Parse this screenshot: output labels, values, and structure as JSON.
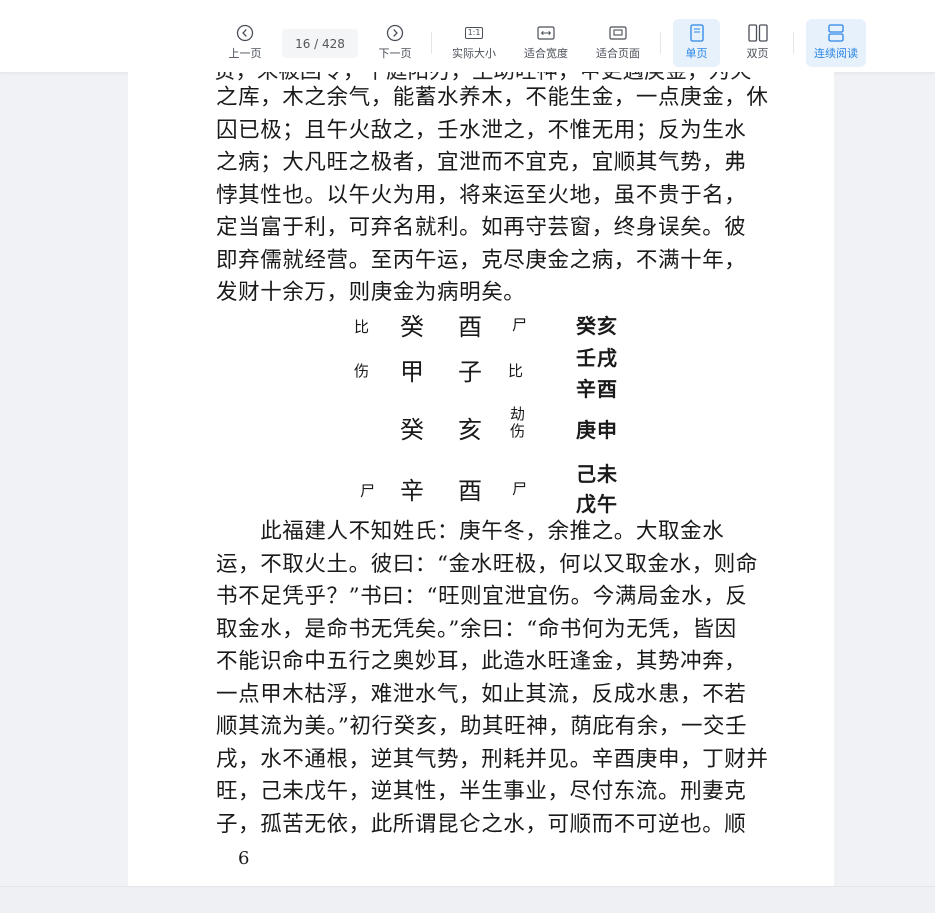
{
  "toolbar": {
    "prev_label": "上一页",
    "page_indicator": "16 / 428",
    "next_label": "下一页",
    "actual_size_label": "实际大小",
    "actual_size_icon_text": "1:1",
    "fit_width_label": "适合宽度",
    "fit_page_label": "适合页面",
    "single_page_label": "单页",
    "double_page_label": "双页",
    "continuous_label": "连续阅读",
    "accent_color": "#2b86e6"
  },
  "document": {
    "partial_top_line": "贵，未被回令，午庭阳刃，生助旺神，甲更遇庚金，为火",
    "para1": [
      "之库，木之余气，能蓄水养木，不能生金，一点庚金，休",
      "囚已极；且午火敌之，壬水泄之，不惟无用；反为生水",
      "之病；大凡旺之极者，宜泄而不宜克，宜顺其气势，弗",
      "悖其性也。以午火为用，将来运至火地，虽不贵于名，",
      "定当富于利，可弃名就利。如再守芸窗，终身误矣。彼",
      "即弃儒就经营。至丙午运，克尽庚金之病，不满十年，",
      "发财十余万，则庚金为病明矣。"
    ],
    "chart": {
      "rows": [
        {
          "left": "比",
          "stem": "癸",
          "branch": "酉",
          "right": "尸"
        },
        {
          "left": "伤",
          "stem": "甲",
          "branch": "子",
          "right": "比"
        },
        {
          "left": "",
          "stem": "癸",
          "branch": "亥",
          "right": "劫伤"
        },
        {
          "left": "尸",
          "stem": "辛",
          "branch": "酉",
          "right": "尸"
        }
      ],
      "luck": [
        "癸亥",
        "壬戌",
        "辛酉",
        "庚申",
        "己未",
        "戊午"
      ]
    },
    "para2": [
      "　　此福建人不知姓氏：庚午冬，余推之。大取金水",
      "运，不取火土。彼曰：“金水旺极，何以又取金水，则命",
      "书不足凭乎？”书曰：“旺则宜泄宜伤。今满局金水，反",
      "取金水，是命书无凭矣。”余曰：“命书何为无凭，皆因",
      "不能识命中五行之奥妙耳，此造水旺逢金，其势冲奔，",
      "一点甲木枯浮，难泄水气，如止其流，反成水患，不若",
      "顺其流为美。”初行癸亥，助其旺神，荫庇有余，一交壬",
      "戌，水不通根，逆其气势，刑耗并见。辛酉庚申，丁财并",
      "旺，己未戊午，逆其性，半生事业，尽付东流。刑妻克",
      "子，孤苦无依，此所谓昆仑之水，可顺而不可逆也。顺"
    ],
    "page_number": "6"
  }
}
